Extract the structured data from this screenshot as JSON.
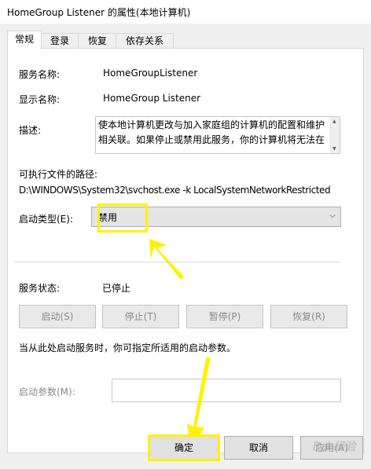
{
  "window": {
    "title": "HomeGroup Listener 的属性(本地计算机)"
  },
  "tabs": [
    {
      "label": "常规",
      "active": true
    },
    {
      "label": "登录",
      "active": false
    },
    {
      "label": "恢复",
      "active": false
    },
    {
      "label": "依存关系",
      "active": false
    }
  ],
  "general": {
    "service_name_label": "服务名称:",
    "service_name_value": "HomeGroupListener",
    "display_name_label": "显示名称:",
    "display_name_value": "HomeGroup Listener",
    "description_label": "描述:",
    "description_text": "使本地计算机更改与加入家庭组的计算机的配置和维护相关联。如果停止或禁用此服务，你的计算机将无法在",
    "exe_path_label": "可执行文件的路径:",
    "exe_path_value": "D:\\WINDOWS\\System32\\svchost.exe -k LocalSystemNetworkRestricted",
    "startup_type_label": "启动类型(E):",
    "startup_type_value": "禁用",
    "service_status_label": "服务状态:",
    "service_status_value": "已停止",
    "start_button": "启动(S)",
    "stop_button": "停止(T)",
    "pause_button": "暂停(P)",
    "resume_button": "恢复(R)",
    "hint_text": "当从此处启动服务时，你可指定所适用的启动参数。",
    "start_params_label": "启动参数(M):",
    "start_params_value": ""
  },
  "footer": {
    "ok_button": "确定",
    "cancel_button": "取消",
    "apply_button": "应用(A)"
  },
  "annotations": {
    "highlight_color": "#fff200",
    "arrow_color": "#fff200"
  },
  "icons": {
    "dropdown": "chevron-down-icon",
    "scroll_up": "scroll-up-icon",
    "scroll_down": "scroll-down-icon"
  },
  "watermark": {
    "text": "Bai 经验"
  }
}
